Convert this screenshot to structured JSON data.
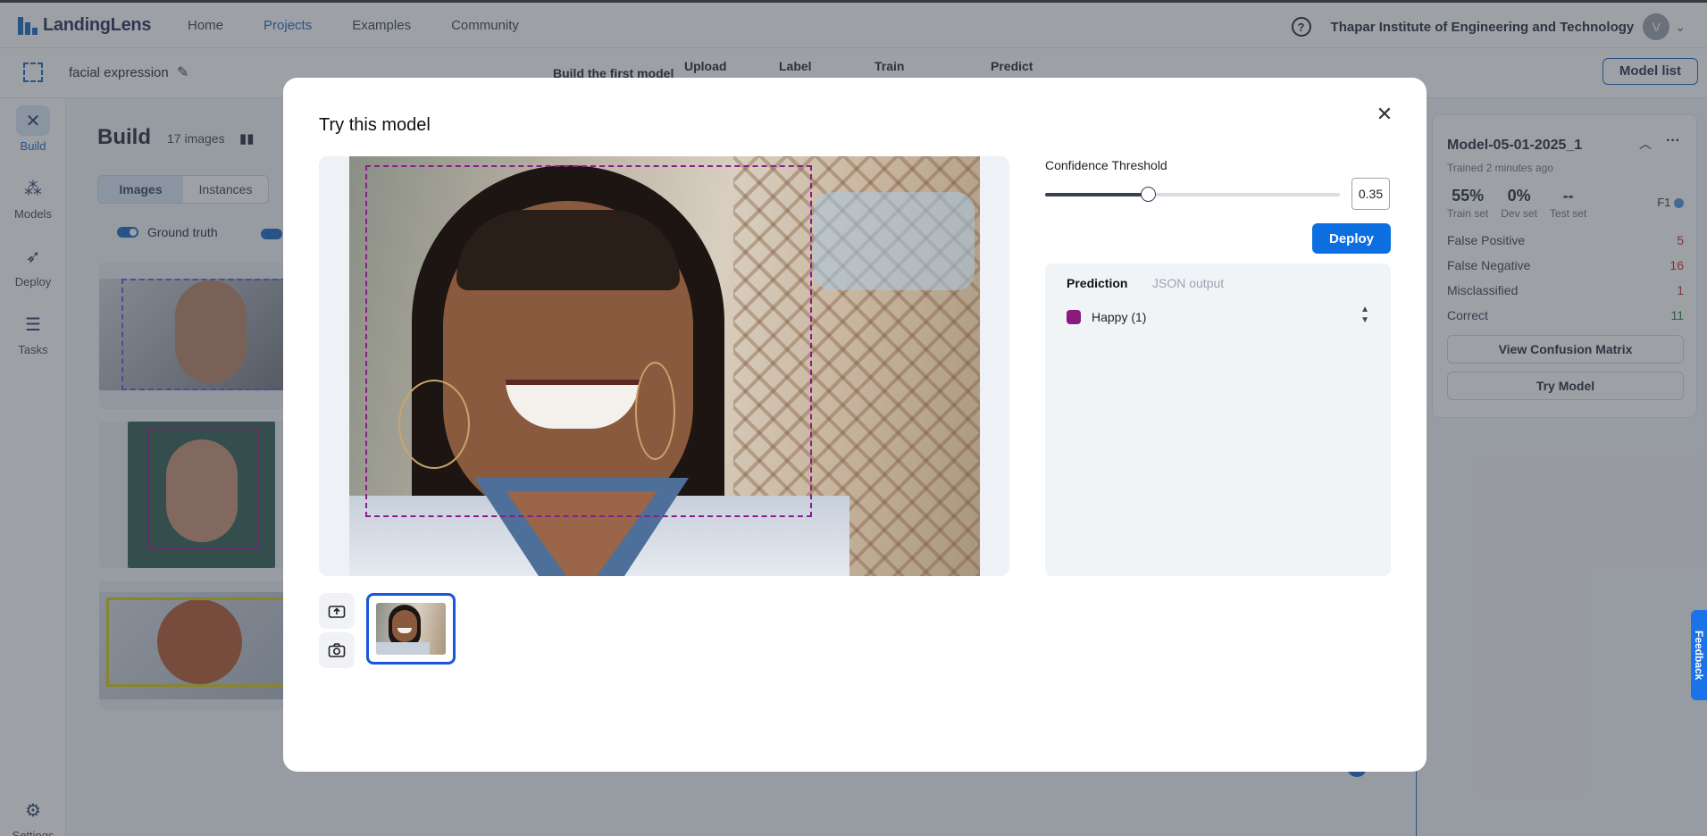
{
  "app": {
    "logo_text": "LandingLens"
  },
  "nav": {
    "items": [
      "Home",
      "Projects",
      "Examples",
      "Community"
    ],
    "active": "Projects"
  },
  "account": {
    "org": "Thapar Institute of Engineering and Technology",
    "avatar_initial": "V"
  },
  "project": {
    "name": "facial expression"
  },
  "steps": {
    "build_first": "Build the first model",
    "upload": "Upload",
    "label": "Label",
    "train": "Train",
    "predict": "Predict"
  },
  "model_list_label": "Model list",
  "sidebar": {
    "items": [
      {
        "label": "Build"
      },
      {
        "label": "Models"
      },
      {
        "label": "Deploy"
      },
      {
        "label": "Tasks"
      },
      {
        "label": "Settings"
      }
    ]
  },
  "build": {
    "title": "Build",
    "count": "17 images",
    "tab_images": "Images",
    "tab_instances": "Instances",
    "ground_truth": "Ground truth"
  },
  "model_panel": {
    "name": "Model-05-01-2025_1",
    "trained": "Trained 2 minutes ago",
    "stats": [
      {
        "value": "55%",
        "label": "Train set"
      },
      {
        "value": "0%",
        "label": "Dev set"
      },
      {
        "value": "--",
        "label": "Test set"
      }
    ],
    "f1": "F1",
    "rows": [
      {
        "label": "False Positive",
        "value": "5",
        "color": "#c62828"
      },
      {
        "label": "False Negative",
        "value": "16",
        "color": "#c62828"
      },
      {
        "label": "Misclassified",
        "value": "1",
        "color": "#c62828"
      },
      {
        "label": "Correct",
        "value": "11",
        "color": "#2e7d32"
      }
    ],
    "view_cm": "View Confusion Matrix",
    "try_model": "Try Model"
  },
  "modal": {
    "title": "Try this model",
    "confidence_label": "Confidence Threshold",
    "confidence_value": "0.35",
    "confidence_level": 0.35,
    "deploy_label": "Deploy",
    "tabs": {
      "prediction": "Prediction",
      "json": "JSON output"
    },
    "prediction": {
      "label": "Happy (1)",
      "color": "#8a1a7e"
    }
  },
  "feedback_label": "Feedback"
}
